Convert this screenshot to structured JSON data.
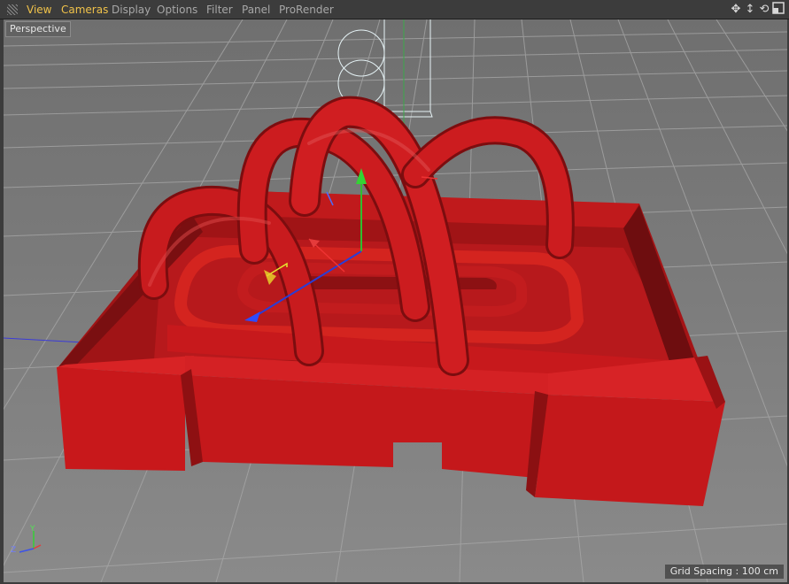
{
  "menu": {
    "items": [
      "View",
      "Cameras",
      "Display",
      "Options",
      "Filter",
      "Panel",
      "ProRender"
    ]
  },
  "nav_icons": [
    "move-view-icon",
    "zoom-view-icon",
    "rotate-view-icon",
    "toggle-layout-icon"
  ],
  "viewport": {
    "label": "Perspective",
    "grid_spacing": "Grid Spacing : 100 cm",
    "axis_labels": {
      "y": "Y",
      "z": "Z",
      "x": "X"
    }
  },
  "colors": {
    "accent_menu": "#f0c24a",
    "object_red": "#c9181b",
    "floor": "#7a7a7a"
  }
}
